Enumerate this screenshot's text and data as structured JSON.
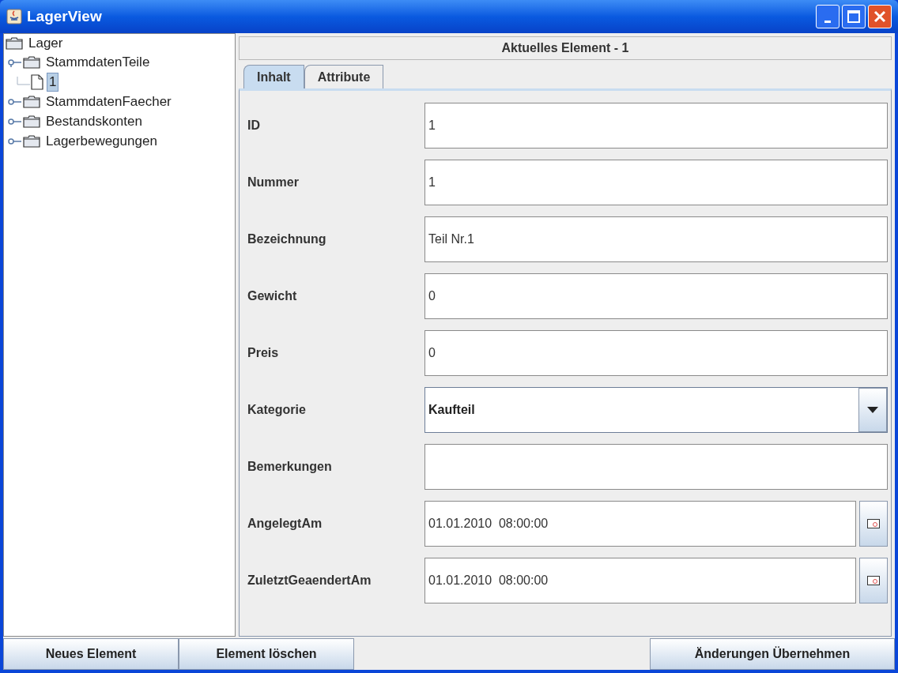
{
  "window": {
    "title": "LagerView"
  },
  "tree": [
    {
      "label": "Lager",
      "kind": "folder",
      "expanded": true,
      "selected": false,
      "children": [
        {
          "label": "StammdatenTeile",
          "kind": "folder",
          "expanded": true,
          "selected": false,
          "children": [
            {
              "label": "1",
              "kind": "document",
              "selected": true
            }
          ]
        },
        {
          "label": "StammdatenFaecher",
          "kind": "folder",
          "expanded": false,
          "selected": false
        },
        {
          "label": "Bestandskonten",
          "kind": "folder",
          "expanded": false,
          "selected": false
        },
        {
          "label": "Lagerbewegungen",
          "kind": "folder",
          "expanded": false,
          "selected": false
        }
      ]
    }
  ],
  "panel": {
    "title": "Aktuelles Element - 1"
  },
  "tabs": [
    {
      "label": "Inhalt",
      "selected": true
    },
    {
      "label": "Attribute",
      "selected": false
    }
  ],
  "fields": [
    {
      "label": "ID",
      "kind": "text",
      "value": "1"
    },
    {
      "label": "Nummer",
      "kind": "text",
      "value": "1"
    },
    {
      "label": "Bezeichnung",
      "kind": "text",
      "value": "Teil Nr.1"
    },
    {
      "label": "Gewicht",
      "kind": "text",
      "value": "0"
    },
    {
      "label": "Preis",
      "kind": "text",
      "value": "0"
    },
    {
      "label": "Kategorie",
      "kind": "combo",
      "value": "Kaufteil"
    },
    {
      "label": "Bemerkungen",
      "kind": "text"
    },
    {
      "label": "AngelegtAm",
      "kind": "date",
      "value": "01.01.2010  08:00:00"
    },
    {
      "label": "ZuletztGeaendertAm",
      "kind": "date",
      "value": "01.01.2010  08:00:00"
    }
  ],
  "left_buttons": [
    "Neues Element",
    "Element löschen"
  ],
  "right_buttons": [
    "Änderungen Übernehmen"
  ]
}
